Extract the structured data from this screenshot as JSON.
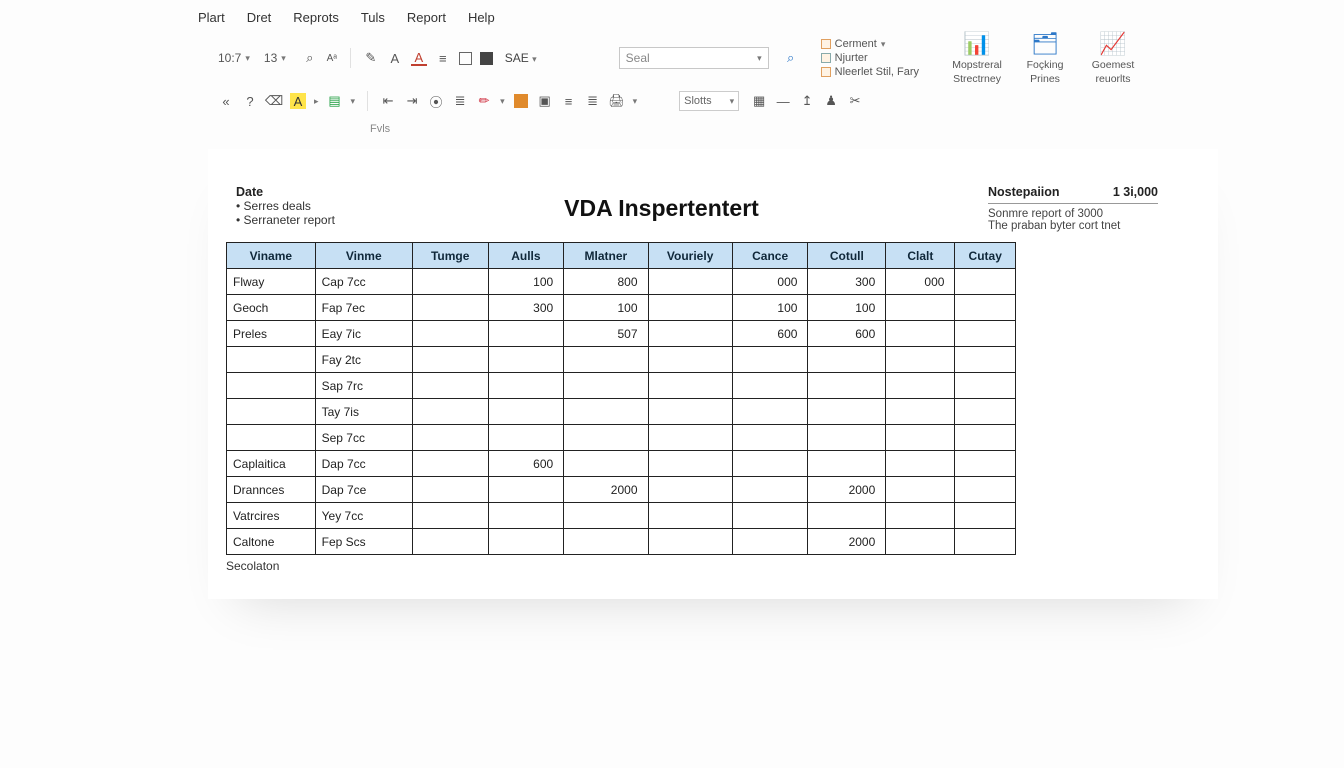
{
  "menu": {
    "items": [
      "Plart",
      "Dret",
      "Reprots",
      "Tuls",
      "Report",
      "Help"
    ]
  },
  "toolbar": {
    "zoom": "10:7",
    "font_size": "13",
    "style_label": "SAE",
    "sort_label": "Slotts",
    "search_placeholder": "Seal",
    "fvls": "Fvls",
    "links": {
      "comment": "Cerment",
      "number": "Njurter",
      "nested": "Nleerlet Stil, Fary"
    },
    "big_buttons": {
      "material": [
        "Mopstreral",
        "Strectrney"
      ],
      "foking": [
        "Foçking",
        "Prines"
      ],
      "goemest": [
        "Goemest",
        "reuorlts"
      ]
    }
  },
  "doc": {
    "date_label": "Date",
    "bullets": [
      "Serres deals",
      "Serraneter report"
    ],
    "title": "VDA Inspertentert",
    "right": {
      "label": "Nostepaiion",
      "value": "1 3i,000",
      "line1": "Sonmre report of 3000",
      "line2": "The praban byter cort tnet"
    },
    "footer": "Secolaton"
  },
  "table": {
    "headers": [
      "Viname",
      "Vinme",
      "Tumge",
      "Aulls",
      "Mlatner",
      "Vouriely",
      "Cance",
      "Cotull",
      "Clalt",
      "Cutay"
    ],
    "rows": [
      {
        "c1": "Flway",
        "c2": "Cap 7cc",
        "c4": "100",
        "c5": "800",
        "c7": "000",
        "c8": "300",
        "c9": "000"
      },
      {
        "c1": "Geoch",
        "c2": "Fap 7ec",
        "c4": "300",
        "c5": "100",
        "c7": "100",
        "c8": "100"
      },
      {
        "c1": "Preles",
        "c2": "Eay 7ic",
        "c5": "507",
        "c7": "600",
        "c8": "600"
      },
      {
        "c2": "Fay 2tc"
      },
      {
        "c2": "Sap 7rc"
      },
      {
        "c2": "Tay 7is"
      },
      {
        "c2": "Sep 7cc"
      },
      {
        "c1": "Caplaitica",
        "c2": "Dap 7cc",
        "c4": "600"
      },
      {
        "c1": "Drannces",
        "c2": "Dap 7ce",
        "c5": "2000",
        "c8": "2000"
      },
      {
        "c1": "Vatrcires",
        "c2": "Yey 7cc"
      },
      {
        "c1": "Caltone",
        "c2": "Fep Scs",
        "c8": "2000"
      }
    ]
  }
}
